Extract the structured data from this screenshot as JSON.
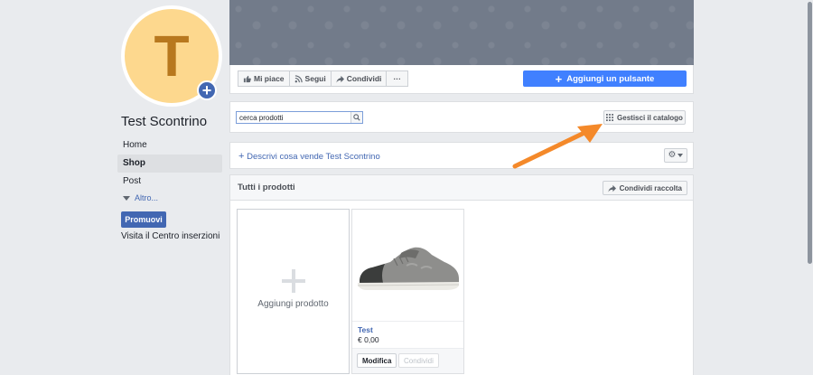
{
  "page": {
    "avatar_letter": "T",
    "name": "Test Scontrino"
  },
  "nav": {
    "items": [
      {
        "label": "Home",
        "active": false
      },
      {
        "label": "Shop",
        "active": true
      },
      {
        "label": "Post",
        "active": false
      }
    ],
    "more_label": "Altro...",
    "promote_label": "Promuovi",
    "ads_center_label": "Visita il Centro inserzioni"
  },
  "action_bar": {
    "like_label": "Mi piace",
    "follow_label": "Segui",
    "share_label": "Condividi",
    "more_label": "···",
    "add_button_label": "Aggiungi un pulsante"
  },
  "shop": {
    "search_value": "cerca prodotti",
    "manage_catalog_label": "Gestisci il catalogo",
    "describe_label": "Descrivi cosa vende Test Scontrino",
    "all_products_title": "Tutti i prodotti",
    "share_collection_label": "Condividi raccolta",
    "add_product_label": "Aggiungi prodotto",
    "products": [
      {
        "name": "Test",
        "price": "€ 0,00",
        "edit_label": "Modifica",
        "share_label": "Condividi"
      }
    ]
  },
  "colors": {
    "accent_blue": "#4080ff",
    "facebook_blue": "#4267b2",
    "annotation_arrow": "#f4892a"
  }
}
